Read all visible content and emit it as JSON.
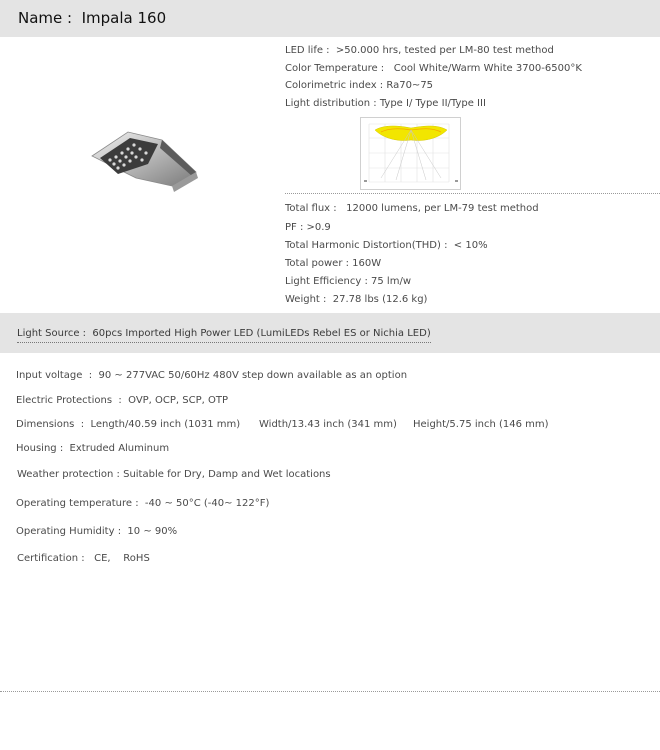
{
  "header": {
    "title": "Name :  Impala 160"
  },
  "specs_top": {
    "led_life": "LED life :  >50.000 hrs, tested per LM-80 test method",
    "color_temperature": "Color Temperature :   Cool White/Warm White 3700-6500°K",
    "colorimetric_index": "Colorimetric index : Ra70~75",
    "light_distribution": "Light distribution : Type I/ Type II/Type III"
  },
  "specs_mid": {
    "total_flux": "Total flux :   12000 lumens, per LM-79 test method",
    "pf": "PF : >0.9",
    "thd": "Total Harmonic Distortion(THD) :  < 10%",
    "total_power": "Total power : 160W",
    "light_efficiency": "Light Efficiency : 75 lm/w",
    "weight": "Weight :  27.78 lbs (12.6 kg)"
  },
  "light_source": "Light Source :  60pcs Imported High Power LED (LumiLEDs Rebel ES or Nichia LED)",
  "specs_lower": {
    "input_voltage": "Input voltage  :  90 ~ 277VAC 50/60Hz 480V step down available as an option",
    "electric_protections": "Electric Protections  :  OVP, OCP, SCP, OTP",
    "dimensions_label": "Dimensions  :  Length/40.59 inch (1031 mm)",
    "dimensions_width": "Width/13.43 inch (341 mm)",
    "dimensions_height": "Height/5.75 inch (146 mm)",
    "housing": "Housing :  Extruded Aluminum",
    "weather_protection": "Weather protection : Suitable for Dry, Damp and Wet locations",
    "operating_temperature": "Operating temperature :  -40 ~ 50°C (-40~ 122°F)",
    "operating_humidity": "Operating Humidity :  10 ~ 90%",
    "certification": "Certification :   CE,    RoHS"
  },
  "colors": {
    "band": "#e4e4e4",
    "text": "#4a4a4a",
    "chart_fill": "#f2e600"
  }
}
